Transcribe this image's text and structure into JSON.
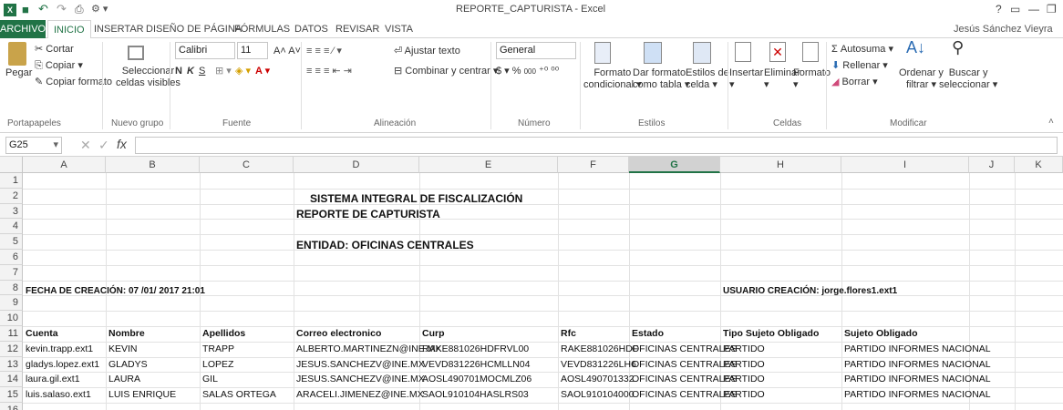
{
  "window": {
    "title": "REPORTE_CAPTURISTA - Excel",
    "user": "Jesús Sánchez Vieyra",
    "controls": [
      "?",
      "▭",
      "—",
      "❐"
    ]
  },
  "tabs": {
    "file": "ARCHIVO",
    "items": [
      "INICIO",
      "INSERTAR",
      "DISEÑO DE PÁGINA",
      "FÓRMULAS",
      "DATOS",
      "REVISAR",
      "VISTA"
    ],
    "active": "INICIO"
  },
  "ribbon": {
    "clipboard": {
      "paste": "Pegar",
      "cut": "Cortar",
      "copy": "Copiar",
      "format_painter": "Copiar formato",
      "label": "Portapapeles"
    },
    "newgroup": {
      "select_visible_1": "Seleccionar",
      "select_visible_2": "celdas visibles",
      "label": "Nuevo grupo"
    },
    "font": {
      "name": "Calibri",
      "size": "11",
      "bold": "N",
      "italic": "K",
      "underline": "S",
      "label": "Fuente"
    },
    "alignment": {
      "wrap": "Ajustar texto",
      "merge": "Combinar y centrar",
      "label": "Alineación"
    },
    "number": {
      "format": "General",
      "currency": "$",
      "percent": "%",
      "thousands": "000",
      "label": "Número"
    },
    "styles": {
      "cond_1": "Formato",
      "cond_2": "condicional",
      "table_1": "Dar formato",
      "table_2": "como tabla",
      "cell_1": "Estilos de",
      "cell_2": "celda",
      "label": "Estilos"
    },
    "cells": {
      "insert": "Insertar",
      "delete": "Eliminar",
      "format": "Formato",
      "label": "Celdas"
    },
    "editing": {
      "autosum": "Autosuma",
      "fill": "Rellenar",
      "clear": "Borrar",
      "sort_1": "Ordenar y",
      "sort_2": "filtrar",
      "find_1": "Buscar y",
      "find_2": "seleccionar",
      "label": "Modificar"
    }
  },
  "formula_bar": {
    "name_box": "G25",
    "fx": "fx",
    "value": ""
  },
  "columns": [
    "A",
    "B",
    "C",
    "D",
    "E",
    "F",
    "G",
    "H",
    "I",
    "J",
    "K"
  ],
  "selected_column": "G",
  "rows": [
    "1",
    "2",
    "3",
    "4",
    "5",
    "6",
    "7",
    "8",
    "9",
    "10",
    "11",
    "12",
    "13",
    "14",
    "15",
    "16"
  ],
  "sheet": {
    "title_1": "SISTEMA INTEGRAL DE FISCALIZACIÓN",
    "title_2": "REPORTE DE CAPTURISTA",
    "entity": "ENTIDAD: OFICINAS CENTRALES",
    "created_date": "FECHA DE CREACIÓN: 07 /01/ 2017 21:01",
    "created_user": "USUARIO CREACIÓN: jorge.flores1.ext1",
    "headers": [
      "Cuenta",
      "Nombre",
      "Apellidos",
      "Correo electronico",
      "Curp",
      "Rfc",
      "Estado",
      "Tipo Sujeto Obligado",
      "Sujeto Obligado"
    ],
    "data": [
      [
        "kevin.trapp.ext1",
        "KEVIN",
        "TRAPP",
        "ALBERTO.MARTINEZN@INE.MX",
        "RAKE881026HDFRVL00",
        "RAKE881026HDF",
        "OFICINAS CENTRALES",
        "PARTIDO",
        "PARTIDO INFORMES NACIONAL"
      ],
      [
        "gladys.lopez.ext1",
        "GLADYS",
        "LOPEZ",
        "JESUS.SANCHEZV@INE.MX",
        "VEVD831226HCMLLN04",
        "VEVD831226LH6",
        "OFICINAS CENTRALES",
        "PARTIDO",
        "PARTIDO INFORMES NACIONAL"
      ],
      [
        "laura.gil.ext1",
        "LAURA",
        "GIL",
        "JESUS.SANCHEZV@INE.MX",
        "AOSL490701MOCMLZ06",
        "AOSL490701332",
        "OFICINAS CENTRALES",
        "PARTIDO",
        "PARTIDO INFORMES NACIONAL"
      ],
      [
        "luis.salaso.ext1",
        "LUIS ENRIQUE",
        "SALAS ORTEGA",
        "ARACELI.JIMENEZ@INE.MX",
        "SAOL910104HASLRS03",
        "SAOL910104000",
        "OFICINAS CENTRALES",
        "PARTIDO",
        "PARTIDO INFORMES NACIONAL"
      ]
    ]
  },
  "colors": {
    "excel_green": "#217346",
    "selected_col_bg": "#d2d2d2",
    "header_bg": "#f3f3f3"
  }
}
